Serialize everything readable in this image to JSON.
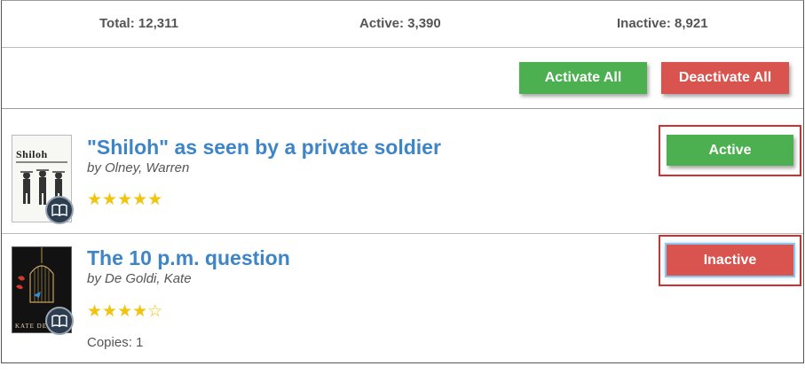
{
  "stats": {
    "total": "Total: 12,311",
    "active": "Active: 3,390",
    "inactive": "Inactive: 8,921"
  },
  "actions": {
    "activate_all": "Activate All",
    "deactivate_all": "Deactivate All"
  },
  "books": [
    {
      "title": "\"Shiloh\" as seen by a private soldier",
      "author": "by Olney, Warren",
      "rating": 5,
      "rating_stars": "★★★★★",
      "cover_title": "Shiloh",
      "status": "Active",
      "status_color": "#4caf50"
    },
    {
      "title": "The 10 p.m. question",
      "author": "by De Goldi, Kate",
      "rating": 4,
      "rating_stars_full": "★★★★",
      "rating_stars_empty": "☆",
      "cover_author": "KATE DE",
      "copies": "Copies: 1",
      "status": "Inactive",
      "status_color": "#d9534f"
    }
  ],
  "colors": {
    "accent_blue": "#3d85c6",
    "green": "#4caf50",
    "red": "#d9534f",
    "star": "#f1c40f",
    "highlight_border": "#d32f2f"
  },
  "icons": {
    "read": "open-book-icon"
  }
}
